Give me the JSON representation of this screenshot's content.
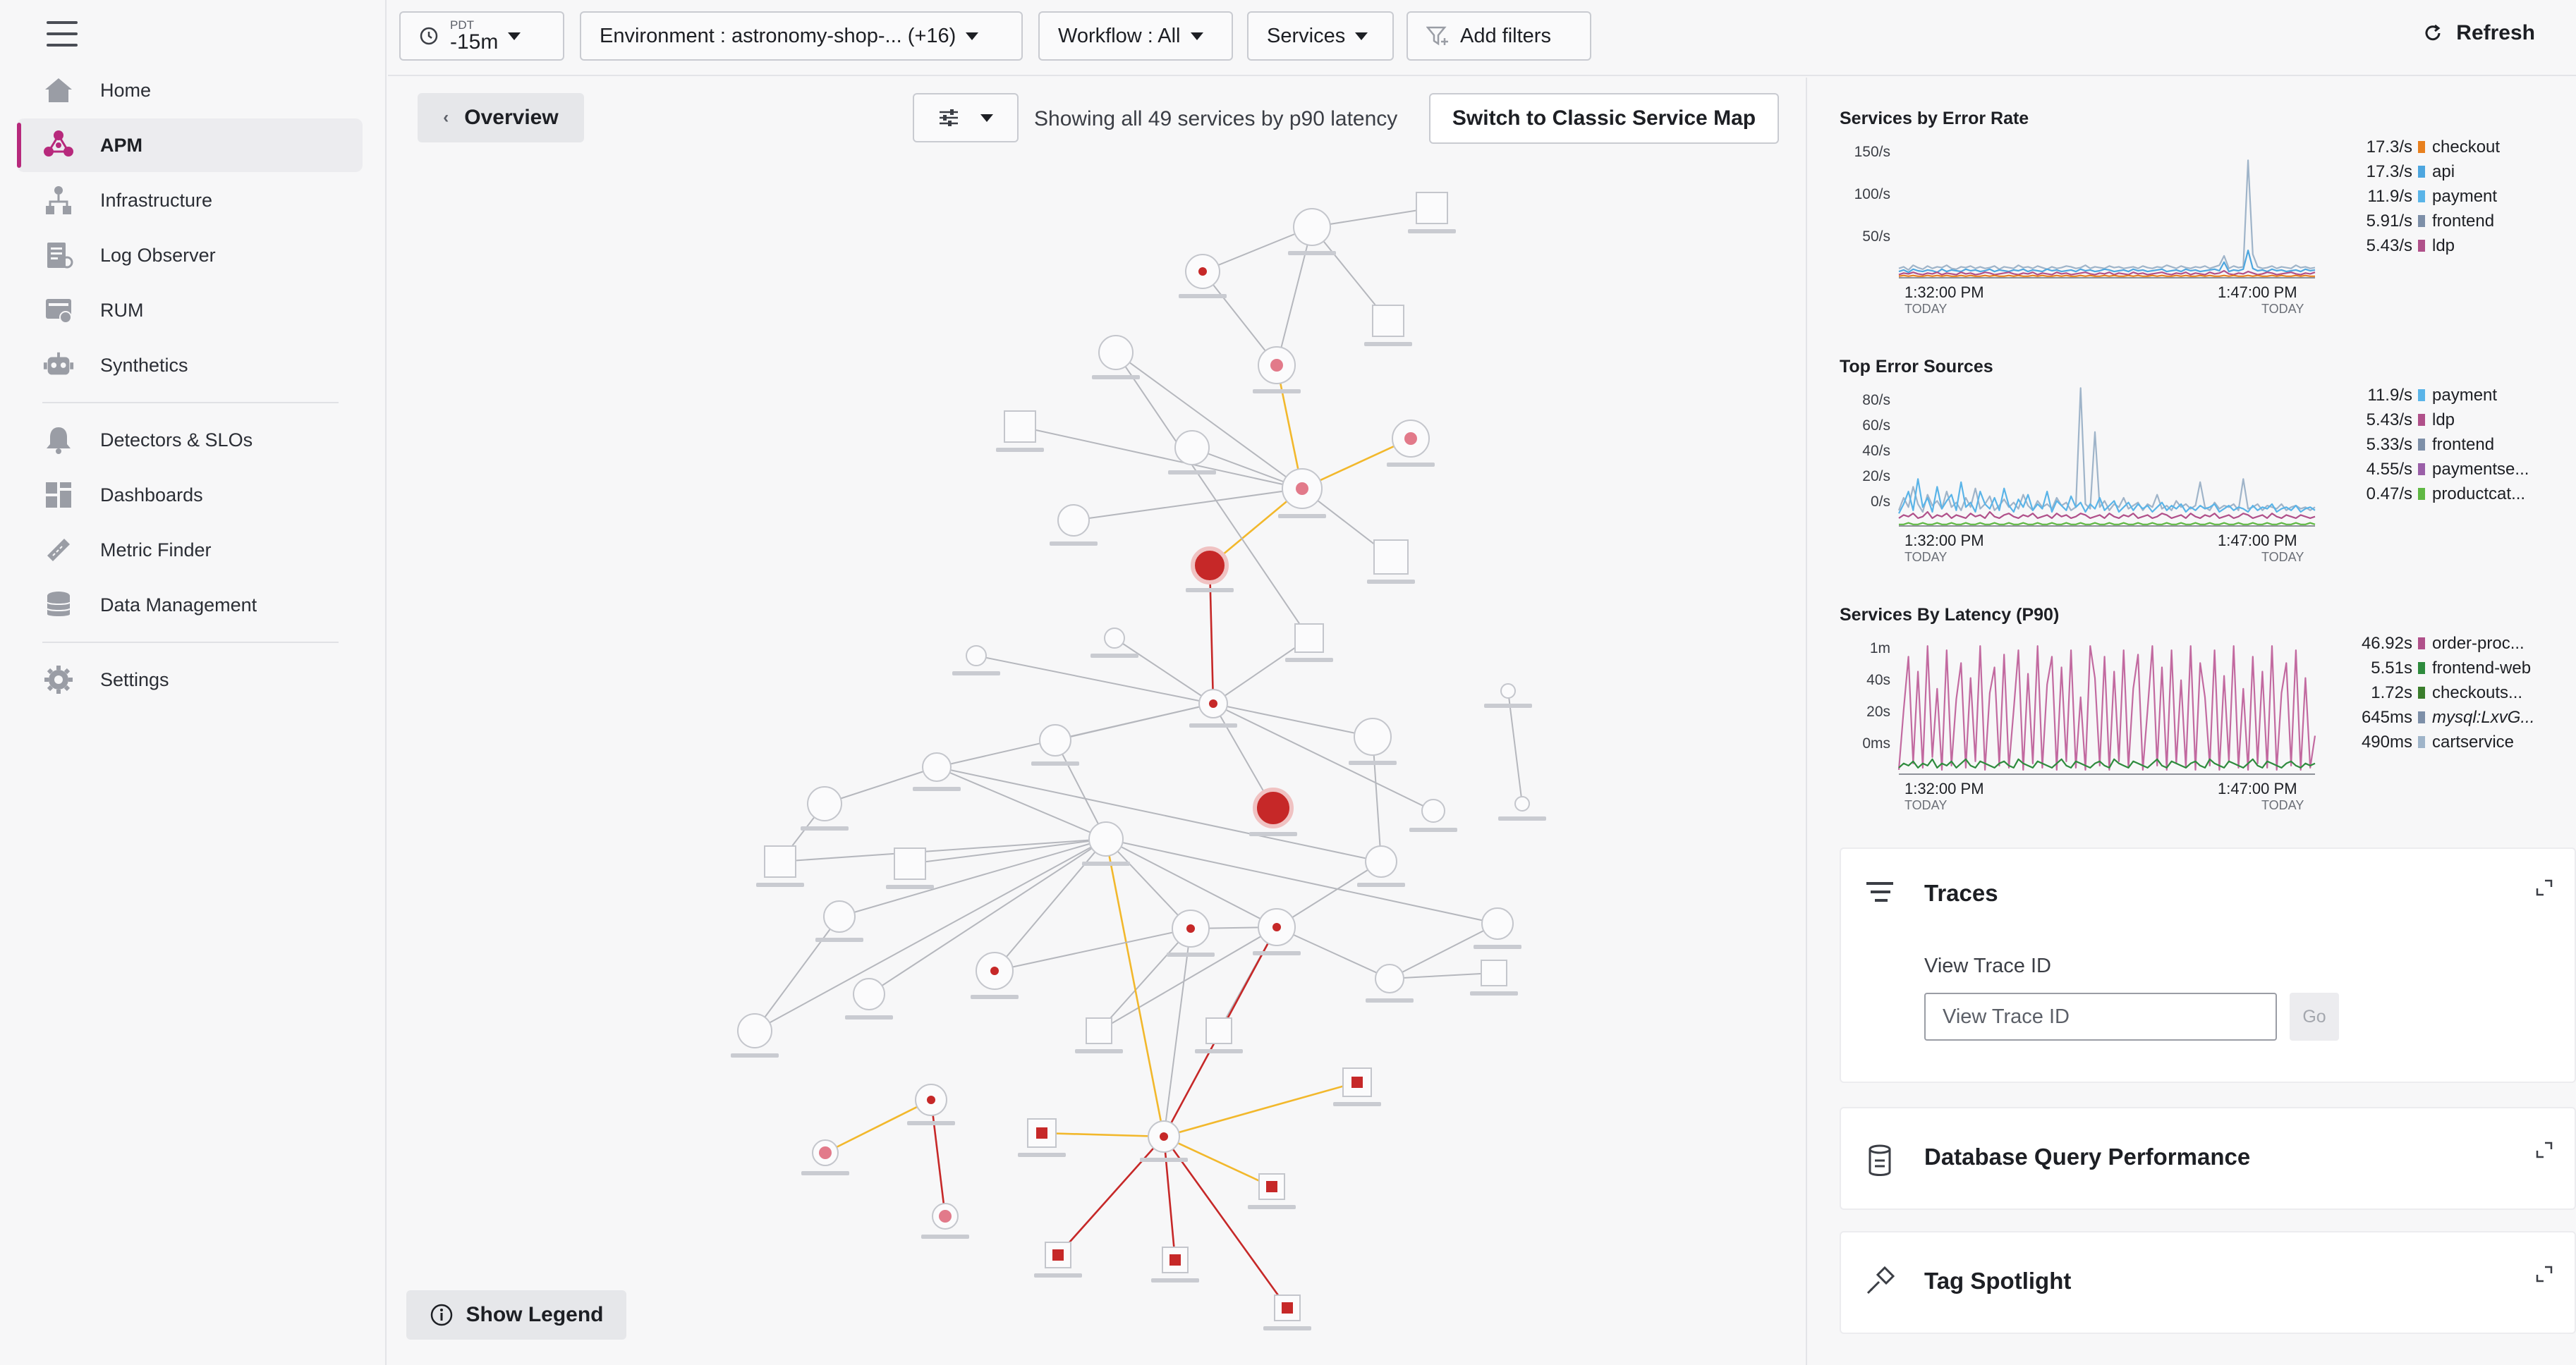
{
  "sidebar": {
    "items": [
      {
        "label": "Home",
        "icon": "home-icon"
      },
      {
        "label": "APM",
        "icon": "apm-icon",
        "active": true
      },
      {
        "label": "Infrastructure",
        "icon": "infrastructure-icon"
      },
      {
        "label": "Log Observer",
        "icon": "log-observer-icon"
      },
      {
        "label": "RUM",
        "icon": "rum-icon"
      },
      {
        "label": "Synthetics",
        "icon": "synthetics-icon"
      },
      {
        "label": "Detectors & SLOs",
        "icon": "bell-icon"
      },
      {
        "label": "Dashboards",
        "icon": "dashboards-icon"
      },
      {
        "label": "Metric Finder",
        "icon": "metric-finder-icon"
      },
      {
        "label": "Data Management",
        "icon": "database-icon"
      },
      {
        "label": "Settings",
        "icon": "gear-icon"
      }
    ]
  },
  "topbar": {
    "time_zone": "PDT",
    "time_range": "-15m",
    "environment": "Environment : astronomy-shop-... (+16)",
    "workflow": "Workflow : All",
    "services": "Services",
    "add_filters": "Add filters",
    "refresh": "Refresh"
  },
  "map": {
    "overview": "Overview",
    "showing": "Showing all 49 services by p90 latency",
    "classic": "Switch to Classic Service Map",
    "show_legend": "Show Legend"
  },
  "panel": {
    "traces": {
      "title": "Traces",
      "label": "View Trace ID",
      "placeholder": "View Trace ID",
      "go": "Go"
    },
    "db": {
      "title": "Database Query Performance"
    },
    "tag": {
      "title": "Tag Spotlight"
    }
  },
  "colors": {
    "accent": "#b7297c",
    "error_red": "#c62828",
    "edge_yellow": "#f2b82c",
    "edge_gray": "#b5b7bd"
  },
  "chart_data": [
    {
      "type": "line",
      "title": "Services by Error Rate",
      "y_ticks": [
        "150/s",
        "100/s",
        "50/s"
      ],
      "x_ticks": [
        {
          "time": "1:32:00 PM",
          "sub": "TODAY"
        },
        {
          "time": "1:47:00 PM",
          "sub": "TODAY"
        }
      ],
      "ylim": [
        0,
        180
      ],
      "legend": [
        {
          "value": "17.3/s",
          "name": "checkout",
          "color": "#e8801e"
        },
        {
          "value": "17.3/s",
          "name": "api",
          "color": "#4da6df"
        },
        {
          "value": "11.9/s",
          "name": "payment",
          "color": "#5ab4e8"
        },
        {
          "value": "5.91/s",
          "name": "frontend",
          "color": "#7d8fa8"
        },
        {
          "value": "5.43/s",
          "name": "ldp",
          "color": "#b0508a"
        }
      ],
      "series": [
        {
          "color": "#9fb4c9",
          "values": [
            12,
            14,
            10,
            16,
            13,
            11,
            15,
            12,
            14,
            13,
            16,
            12,
            11,
            14,
            13,
            15,
            12,
            14,
            12,
            13,
            15,
            11,
            14,
            13,
            12,
            16,
            13,
            14,
            12,
            15,
            13,
            11,
            14,
            12,
            13,
            15,
            14,
            12,
            13,
            16,
            12,
            14,
            13,
            12,
            15,
            13,
            14,
            12,
            13,
            14,
            12,
            15,
            13,
            12,
            14,
            13,
            16,
            14,
            12,
            15,
            13,
            12,
            14,
            13,
            15,
            12,
            14,
            16,
            28,
            12,
            15,
            13,
            14,
            150,
            30,
            14,
            12,
            13,
            15,
            12,
            14,
            13,
            12,
            16,
            13,
            14,
            12,
            13
          ]
        },
        {
          "color": "#4da6df",
          "values": [
            8,
            10,
            7,
            11,
            9,
            8,
            10,
            9,
            7,
            11,
            8,
            10,
            9,
            8,
            11,
            9,
            10,
            8,
            9,
            11,
            8,
            10,
            9,
            8,
            10,
            9,
            11,
            8,
            10,
            9,
            8,
            11,
            9,
            10,
            8,
            9,
            10,
            8,
            11,
            9,
            10,
            8,
            9,
            11,
            10,
            8,
            9,
            10,
            8,
            11,
            9,
            10,
            8,
            9,
            10,
            11,
            8,
            9,
            10,
            8,
            11,
            9,
            10,
            8,
            9,
            10,
            11,
            9,
            20,
            8,
            10,
            9,
            11,
            35,
            12,
            9,
            10,
            8,
            11,
            9,
            10,
            8,
            9,
            10,
            8,
            11,
            9,
            10
          ]
        },
        {
          "color": "#b0508a",
          "values": [
            4,
            6,
            5,
            7,
            5,
            4,
            6,
            5,
            7,
            4,
            6,
            5,
            4,
            7,
            5,
            6,
            4,
            5,
            7,
            6,
            4,
            5,
            6,
            7,
            5,
            4,
            6,
            5,
            7,
            4,
            6,
            5,
            4,
            7,
            5,
            6,
            4,
            5,
            6,
            7,
            5,
            4,
            6,
            5,
            7,
            4,
            6,
            5,
            4,
            7,
            5,
            6,
            4,
            5,
            6,
            7,
            5,
            4,
            6,
            5,
            7,
            4,
            6,
            5,
            4,
            7,
            5,
            6,
            9,
            5,
            4,
            6,
            5,
            8,
            6,
            4,
            5,
            7,
            6,
            4,
            5,
            6,
            7,
            5,
            4,
            6,
            5,
            7
          ]
        },
        {
          "color": "#e8801e",
          "values": [
            2,
            3,
            2,
            3,
            2,
            2,
            3,
            2,
            3,
            2,
            3,
            2,
            2,
            3,
            2,
            3,
            2,
            2,
            3,
            2,
            3,
            2,
            2,
            3,
            2,
            3,
            2,
            2,
            3,
            2,
            3,
            2,
            2,
            3,
            2,
            3,
            2,
            2,
            3,
            2,
            3,
            2,
            2,
            3,
            2,
            3,
            2,
            2,
            3,
            2,
            3,
            2,
            2,
            3,
            2,
            3,
            2,
            2,
            3,
            2,
            3,
            2,
            2,
            3,
            2,
            3,
            2,
            2,
            3,
            2,
            3,
            2,
            2,
            3,
            2,
            3,
            2,
            2,
            3,
            2,
            3,
            2,
            2,
            3,
            2,
            3,
            2,
            2
          ]
        }
      ]
    },
    {
      "type": "line",
      "title": "Top Error Sources",
      "y_ticks": [
        "80/s",
        "60/s",
        "40/s",
        "20/s",
        "0/s"
      ],
      "x_ticks": [
        {
          "time": "1:32:00 PM",
          "sub": "TODAY"
        },
        {
          "time": "1:47:00 PM",
          "sub": "TODAY"
        }
      ],
      "ylim": [
        0,
        90
      ],
      "legend": [
        {
          "value": "11.9/s",
          "name": "payment",
          "color": "#5ab4e8"
        },
        {
          "value": "5.43/s",
          "name": "ldp",
          "color": "#b0508a"
        },
        {
          "value": "5.33/s",
          "name": "frontend",
          "color": "#7d8fa8"
        },
        {
          "value": "4.55/s",
          "name": "paymentse...",
          "color": "#9a5fa8"
        },
        {
          "value": "0.47/s",
          "name": "productcat...",
          "color": "#5fb843"
        }
      ],
      "series": [
        {
          "color": "#9fb4c9",
          "values": [
            10,
            18,
            12,
            25,
            14,
            9,
            20,
            13,
            16,
            11,
            22,
            12,
            15,
            10,
            18,
            12,
            24,
            11,
            14,
            19,
            10,
            13,
            17,
            12,
            15,
            11,
            20,
            13,
            10,
            16,
            12,
            14,
            11,
            18,
            13,
            15,
            10,
            12,
            88,
            14,
            11,
            60,
            12,
            16,
            10,
            14,
            12,
            18,
            11,
            13,
            15,
            10,
            14,
            12,
            20,
            11,
            13,
            10,
            16,
            12,
            14,
            11,
            13,
            28,
            12,
            10,
            15,
            11,
            13,
            12,
            14,
            10,
            30,
            11,
            12,
            14,
            10,
            13,
            12,
            11,
            14,
            10,
            12,
            13,
            11,
            12,
            10,
            12
          ]
        },
        {
          "color": "#5ab4e8",
          "values": [
            8,
            14,
            22,
            10,
            30,
            12,
            18,
            9,
            25,
            11,
            16,
            20,
            10,
            28,
            12,
            15,
            9,
            22,
            14,
            11,
            18,
            10,
            24,
            13,
            9,
            17,
            12,
            20,
            10,
            14,
            11,
            22,
            9,
            16,
            13,
            10,
            19,
            12,
            15,
            9,
            14,
            11,
            18,
            10,
            13,
            16,
            9,
            12,
            15,
            10,
            14,
            11,
            13,
            9,
            12,
            15,
            10,
            13,
            11,
            14,
            9,
            12,
            10,
            13,
            11,
            12,
            14,
            9,
            11,
            13,
            10,
            12,
            11,
            9,
            13,
            10,
            12,
            11,
            14,
            9,
            11,
            12,
            10,
            13,
            9,
            11,
            12,
            10
          ]
        },
        {
          "color": "#b0508a",
          "values": [
            5,
            7,
            6,
            8,
            5,
            6,
            9,
            5,
            7,
            6,
            8,
            5,
            7,
            6,
            5,
            8,
            6,
            7,
            5,
            9,
            6,
            5,
            7,
            8,
            6,
            5,
            7,
            6,
            8,
            5,
            6,
            7,
            5,
            8,
            6,
            7,
            5,
            6,
            8,
            7,
            5,
            6,
            7,
            5,
            8,
            6,
            5,
            7,
            6,
            8,
            5,
            6,
            7,
            5,
            6,
            8,
            7,
            5,
            6,
            7,
            5,
            8,
            6,
            5,
            7,
            6,
            8,
            5,
            6,
            7,
            5,
            6,
            8,
            7,
            5,
            6,
            7,
            5,
            8,
            6,
            5,
            7,
            6,
            5,
            7,
            6,
            5,
            6
          ]
        },
        {
          "color": "#5fb843",
          "values": [
            1,
            1,
            2,
            1,
            1,
            2,
            1,
            1,
            2,
            1,
            1,
            2,
            1,
            1,
            2,
            1,
            1,
            2,
            1,
            1,
            2,
            1,
            1,
            2,
            1,
            1,
            2,
            1,
            1,
            2,
            1,
            1,
            2,
            1,
            1,
            2,
            1,
            1,
            2,
            1,
            1,
            2,
            1,
            1,
            2,
            1,
            1,
            2,
            1,
            1,
            2,
            1,
            1,
            2,
            1,
            1,
            2,
            1,
            1,
            2,
            1,
            1,
            2,
            1,
            1,
            2,
            1,
            1,
            2,
            1,
            1,
            2,
            1,
            1,
            2,
            1,
            1,
            2,
            1,
            1,
            2,
            1,
            1,
            2,
            1,
            1,
            2,
            1
          ]
        }
      ]
    },
    {
      "type": "line",
      "title": "Services By Latency (P90)",
      "y_ticks": [
        "1m",
        "40s",
        "20s",
        "0ms"
      ],
      "x_ticks": [
        {
          "time": "1:32:00 PM",
          "sub": "TODAY"
        },
        {
          "time": "1:47:00 PM",
          "sub": "TODAY"
        }
      ],
      "ylim": [
        0,
        66
      ],
      "legend": [
        {
          "value": "46.92s",
          "name": "order-proc...",
          "color": "#b0508a"
        },
        {
          "value": "5.51s",
          "name": "frontend-web",
          "color": "#2e8b3d"
        },
        {
          "value": "1.72s",
          "name": "checkouts...",
          "color": "#3a7d2c"
        },
        {
          "value": "645ms",
          "name": "mysql:LxvG...",
          "color": "#7d8fa8",
          "italic": true
        },
        {
          "value": "490ms",
          "name": "cartservice",
          "color": "#9fb4c9"
        }
      ],
      "series": [
        {
          "color": "#c26aa0",
          "values": [
            2,
            30,
            55,
            5,
            48,
            3,
            60,
            8,
            40,
            2,
            58,
            4,
            35,
            52,
            3,
            45,
            6,
            60,
            2,
            38,
            50,
            4,
            56,
            3,
            30,
            58,
            2,
            47,
            5,
            60,
            3,
            42,
            55,
            2,
            50,
            6,
            58,
            3,
            36,
            2,
            60,
            45,
            4,
            55,
            2,
            48,
            6,
            58,
            3,
            40,
            56,
            2,
            30,
            60,
            4,
            50,
            2,
            58,
            5,
            44,
            3,
            60,
            2,
            52,
            36,
            4,
            58,
            2,
            46,
            6,
            60,
            3,
            40,
            2,
            55,
            5,
            48,
            3,
            60,
            2,
            38,
            52,
            4,
            58,
            2,
            45,
            3,
            18
          ]
        },
        {
          "color": "#2e8b3d",
          "values": [
            3,
            5,
            4,
            6,
            3,
            5,
            4,
            7,
            3,
            5,
            4,
            6,
            3,
            5,
            7,
            4,
            3,
            6,
            5,
            4,
            3,
            5,
            6,
            4,
            3,
            7,
            5,
            4,
            3,
            6,
            5,
            4,
            3,
            5,
            7,
            4,
            3,
            6,
            5,
            4,
            3,
            5,
            6,
            4,
            3,
            7,
            5,
            4,
            3,
            6,
            5,
            4,
            3,
            5,
            7,
            4,
            3,
            6,
            5,
            4,
            3,
            5,
            6,
            4,
            3,
            7,
            5,
            4,
            3,
            6,
            5,
            4,
            3,
            5,
            7,
            4,
            3,
            6,
            5,
            4,
            3,
            5,
            6,
            4,
            3,
            5,
            4,
            5
          ]
        }
      ]
    }
  ]
}
